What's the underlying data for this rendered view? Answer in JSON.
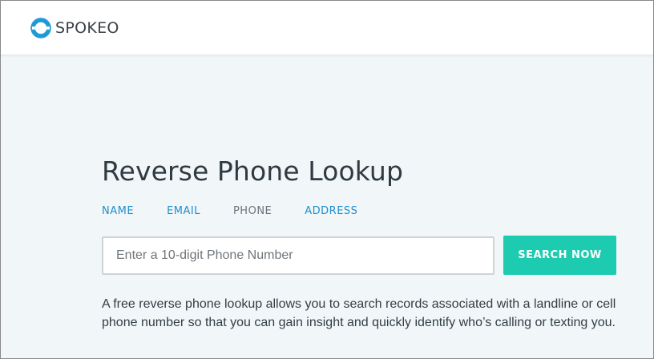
{
  "brand": {
    "name": "SPOKEO",
    "logo_icon": "spokeo-ring-icon",
    "color": "#1e9ad6"
  },
  "page": {
    "title": "Reverse Phone Lookup"
  },
  "tabs": [
    {
      "label": "NAME",
      "active": false
    },
    {
      "label": "EMAIL",
      "active": false
    },
    {
      "label": "PHONE",
      "active": true
    },
    {
      "label": "ADDRESS",
      "active": false
    }
  ],
  "search": {
    "value": "",
    "placeholder": "Enter a 10-digit Phone Number",
    "button_label": "SEARCH NOW",
    "button_color": "#1ccbb0"
  },
  "description": "A free reverse phone lookup allows you to search records associated with a landline or cell phone number so that you can gain insight and quickly identify who’s calling or texting you."
}
